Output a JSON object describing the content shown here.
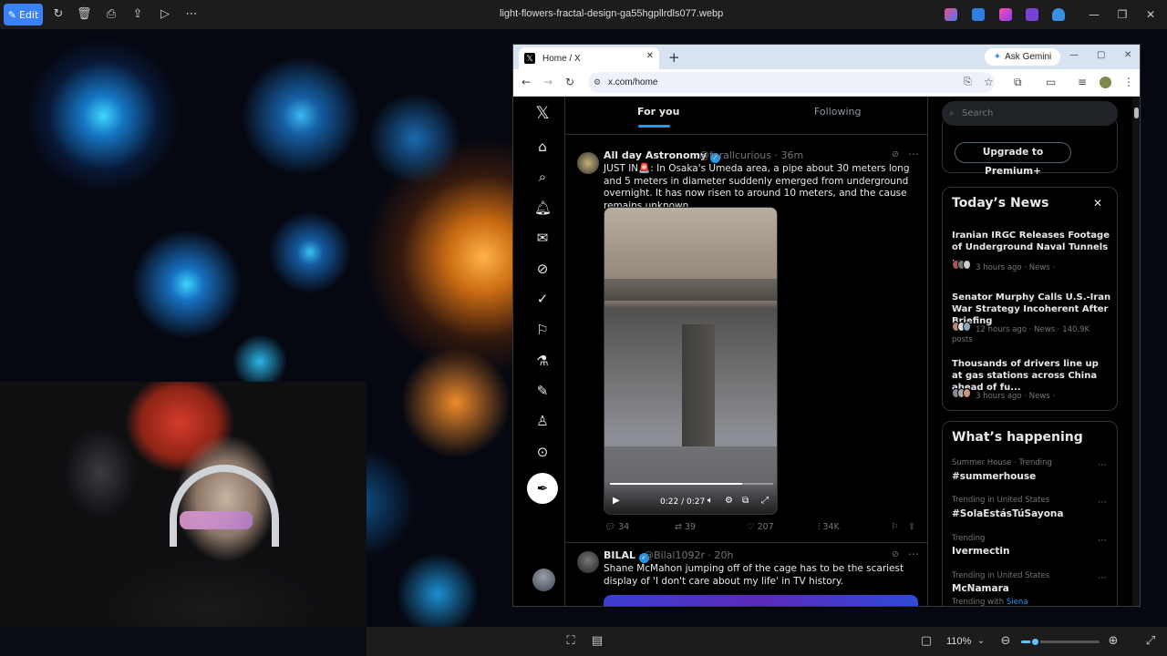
{
  "photos_app": {
    "edit_label": "Edit",
    "filename": "light-flowers-fractal-design-ga55hgpllrdls077.webp",
    "zoom": "110%",
    "zoom_fraction": 0.18
  },
  "browser": {
    "tab_title": "Home / X",
    "gemini_label": "Ask Gemini",
    "url": "x.com/home"
  },
  "feed": {
    "tab_for_you": "For you",
    "tab_following": "Following",
    "tweets": [
      {
        "name": "All day Astronomy",
        "handle": "@forallcurious · 36m",
        "text": "JUST IN🚨: In Osaka's Umeda area, a pipe about 30 meters long and 5 meters in diameter suddenly emerged from underground overnight. It has now risen to around 10 meters, and the cause remains unknown.",
        "video_time": "0:22 / 0:27",
        "video_progress": 0.81,
        "replies": "34",
        "reposts": "39",
        "likes": "207",
        "views": "34K"
      },
      {
        "name": "BILAL",
        "handle": "@Bilal1092r · 20h",
        "text": "Shane McMahon jumping off of the cage has to be the scariest display of 'I don't care about my life' in TV history."
      }
    ]
  },
  "sidebar": {
    "search_placeholder": "Search",
    "premium_label": "Upgrade to Premium+",
    "news_title": "Today’s News",
    "news": [
      {
        "headline": "Iranian IRGC Releases Footage of Underground Naval Tunnels ...",
        "meta": "3 hours ago · News ·"
      },
      {
        "headline": "Senator Murphy Calls U.S.-Iran War Strategy Incoherent After Briefing",
        "meta": "12 hours ago · News · 140.9K posts"
      },
      {
        "headline": "Thousands of drivers line up at gas stations across China ahead of fu...",
        "meta": "3 hours ago · News ·"
      }
    ],
    "happening_title": "What’s happening",
    "trends": [
      {
        "meta": "Summer House · Trending",
        "tag": "#summerhouse"
      },
      {
        "meta": "Trending in United States",
        "tag": "#SolaEstásTúSayona"
      },
      {
        "meta": "Trending",
        "tag": "Ivermectin"
      },
      {
        "meta": "Trending in United States",
        "tag": "McNamara",
        "extra_prefix": "Trending with",
        "extra_link": "Siena"
      }
    ]
  },
  "colors": {
    "accent": "#1d9bf0",
    "photos_accent": "#3b82f6"
  }
}
